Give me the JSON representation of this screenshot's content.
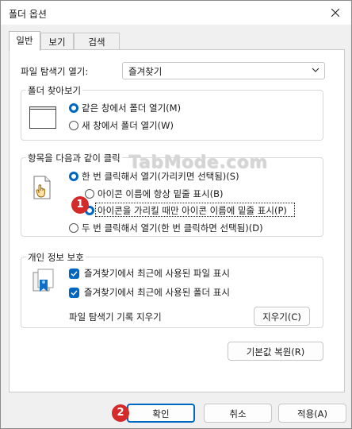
{
  "window": {
    "title": "폴더 옵션"
  },
  "tabs": [
    {
      "label": "일반"
    },
    {
      "label": "보기"
    },
    {
      "label": "검색"
    }
  ],
  "open_explorer": {
    "label": "파일 탐색기 열기:",
    "value": "즐겨찾기"
  },
  "browse_folders": {
    "title": "폴더 찾아보기",
    "options": [
      {
        "label": "같은 창에서 폴더 열기(M)"
      },
      {
        "label": "새 창에서 폴더 열기(W)"
      }
    ],
    "selected": 0
  },
  "click_items": {
    "title": "항목을 다음과 같이 클릭",
    "single_click": "한 번 클릭해서 열기(가리키면 선택됨)(S)",
    "underline_always": "아이콘 이름에 항상 밑줄 표시(B)",
    "underline_hover": "아이콘을 가리킬 때만 아이콘 이름에 밑줄 표시(P)",
    "double_click": "두 번 클릭해서 열기(한 번 클릭하면 선택됨)(D)"
  },
  "privacy": {
    "title": "개인 정보 보호",
    "recent_files": "즐겨찾기에서 최근에 사용된 파일 표시",
    "recent_folders": "즐겨찾기에서 최근에 사용된 폴더 표시",
    "clear_label": "파일 탐색기 기록 지우기",
    "clear_button": "지우기(C)"
  },
  "restore_defaults": "기본값 복원(R)",
  "footer": {
    "ok": "확인",
    "cancel": "취소",
    "apply": "적용(A)"
  },
  "badges": {
    "one": "1",
    "two": "2"
  },
  "watermark": "TabMode.com",
  "colors": {
    "accent": "#0067c0",
    "badge": "#d42a2a"
  }
}
